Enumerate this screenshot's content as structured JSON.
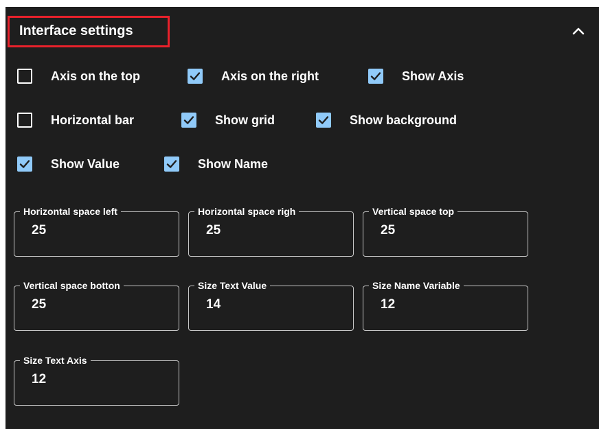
{
  "header": {
    "title": "Interface settings",
    "collapse_icon": "chevron-up-icon",
    "highlight_color": "#e8212b"
  },
  "colors": {
    "background": "#1e1e1e",
    "checkbox_checked": "#90caf9",
    "text": "#ffffff",
    "field_border": "#c7c7c7"
  },
  "checkboxes": [
    {
      "label": "Axis on the top",
      "checked": false
    },
    {
      "label": "Axis on the right",
      "checked": true
    },
    {
      "label": "Show Axis",
      "checked": true
    },
    {
      "label": "Horizontal bar",
      "checked": false
    },
    {
      "label": "Show grid",
      "checked": true
    },
    {
      "label": "Show background",
      "checked": true
    },
    {
      "label": "Show Value",
      "checked": true
    },
    {
      "label": "Show Name",
      "checked": true
    }
  ],
  "fields": [
    {
      "label": "Horizontal space left",
      "value": "25"
    },
    {
      "label": "Horizontal space righ",
      "value": "25"
    },
    {
      "label": "Vertical space top",
      "value": "25"
    },
    {
      "label": "Vertical space botton",
      "value": "25"
    },
    {
      "label": "Size Text Value",
      "value": "14"
    },
    {
      "label": "Size Name Variable",
      "value": "12"
    },
    {
      "label": "Size Text Axis",
      "value": "12"
    }
  ]
}
